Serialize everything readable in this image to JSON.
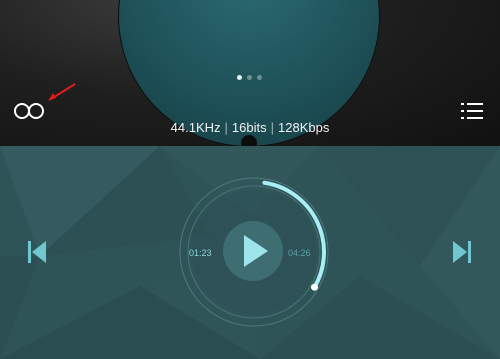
{
  "top": {
    "audio_info": {
      "sample_rate": "44.1KHz",
      "bit_depth": "16bits",
      "bitrate": "128Kbps"
    },
    "page_indicator": {
      "count": 3,
      "active": 1
    }
  },
  "player": {
    "current_time": "01:23",
    "total_time": "04:26",
    "progress": 0.31
  },
  "colors": {
    "accent": "#8fd7df",
    "bottom_bg": "#2f5458",
    "top_bg": "#111111",
    "annotation_arrow": "#e01b1b"
  },
  "icons": {
    "loop": "loop-icon",
    "menu": "menu-icon",
    "prev": "skip-previous-icon",
    "next": "skip-next-icon",
    "play": "play-icon",
    "arrow": "annotation-arrow"
  }
}
